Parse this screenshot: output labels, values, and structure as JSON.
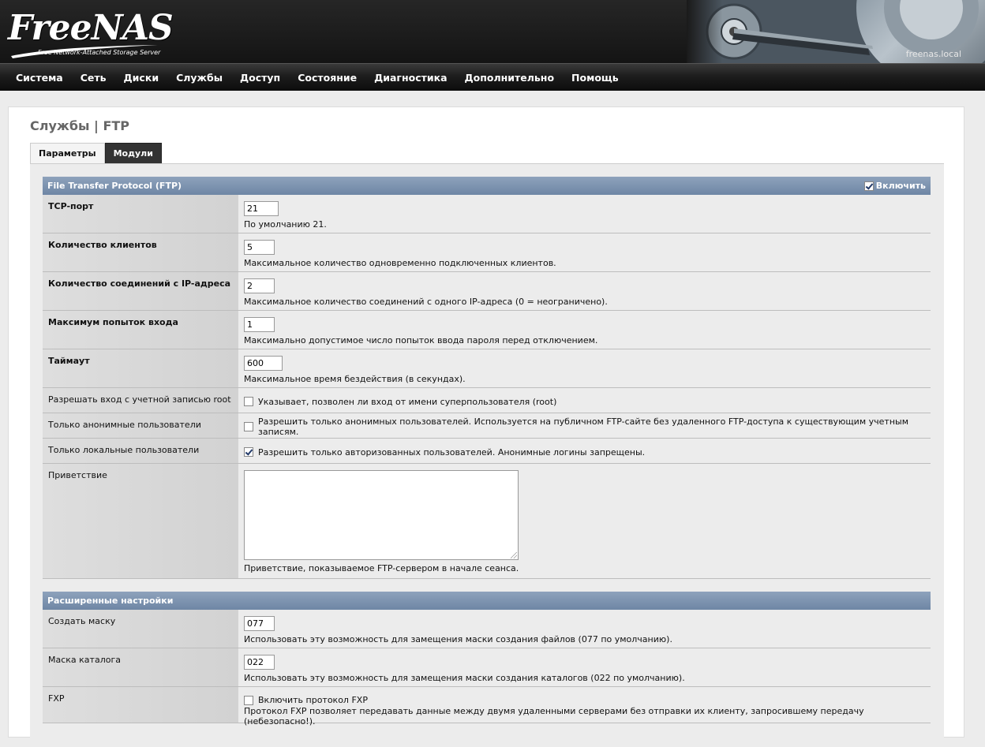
{
  "header": {
    "logo_text": "FreeNAS",
    "logo_subtitle": "Free Network-Attached Storage Server",
    "hostname": "freenas.local"
  },
  "nav": {
    "items": [
      "Система",
      "Сеть",
      "Диски",
      "Службы",
      "Доступ",
      "Состояние",
      "Диагностика",
      "Дополнительно",
      "Помощь"
    ]
  },
  "page": {
    "title": "Службы | FTP",
    "tabs": [
      {
        "label": "Параметры",
        "active": true
      },
      {
        "label": "Модули",
        "active": false
      }
    ]
  },
  "section_ftp": {
    "title": "File Transfer Protocol (FTP)",
    "enable_label": "Включить",
    "enable_checked": true,
    "rows": [
      {
        "label": "TCP-порт",
        "value": "21",
        "hint": "По умолчанию 21."
      },
      {
        "label": "Количество клиентов",
        "value": "5",
        "hint": "Максимальное количество одновременно подключенных клиентов."
      },
      {
        "label": "Количество соединений с IP-адреса",
        "value": "2",
        "hint": "Максимальное количество соединений с одного IP-адреса (0 = неограничено)."
      },
      {
        "label": "Максимум попыток входа",
        "value": "1",
        "hint": "Максимально допустимое число попыток ввода пароля перед отключением."
      },
      {
        "label": "Таймаут",
        "value": "600",
        "hint": "Максимальное время бездействия (в секундах)."
      }
    ],
    "checks": [
      {
        "label": "Разрешать вход с учетной записью root",
        "text": "Указывает, позволен ли вход от имени суперпользователя (root)",
        "checked": false
      },
      {
        "label": "Только анонимные пользователи",
        "text": "Разрешить только анонимных пользователей. Используется на публичном FTP-сайте без удаленного FTP-доступа к существующим учетным записям.",
        "checked": false
      },
      {
        "label": "Только локальные пользователи",
        "text": "Разрешить только авторизованных пользователей. Анонимные логины запрещены.",
        "checked": true
      }
    ],
    "greeting": {
      "label": "Приветствие",
      "value": "",
      "hint": "Приветствие, показываемое FTP-сервером в начале сеанса."
    }
  },
  "section_advanced": {
    "title": "Расширенные настройки",
    "rows": [
      {
        "label": "Создать маску",
        "value": "077",
        "hint": "Использовать эту возможность для замещения маски создания файлов (077 по умолчанию)."
      },
      {
        "label": "Маска каталога",
        "value": "022",
        "hint": "Использовать эту возможность для замещения маски создания каталогов (022 по умолчанию)."
      }
    ],
    "fxp": {
      "label": "FXP",
      "text": "Включить протокол FXP",
      "checked": false,
      "hint": "Протокол FXP позволяет передавать данные между двумя удаленными серверами без отправки их клиенту, запросившему передачу (небезопасно!)."
    }
  }
}
